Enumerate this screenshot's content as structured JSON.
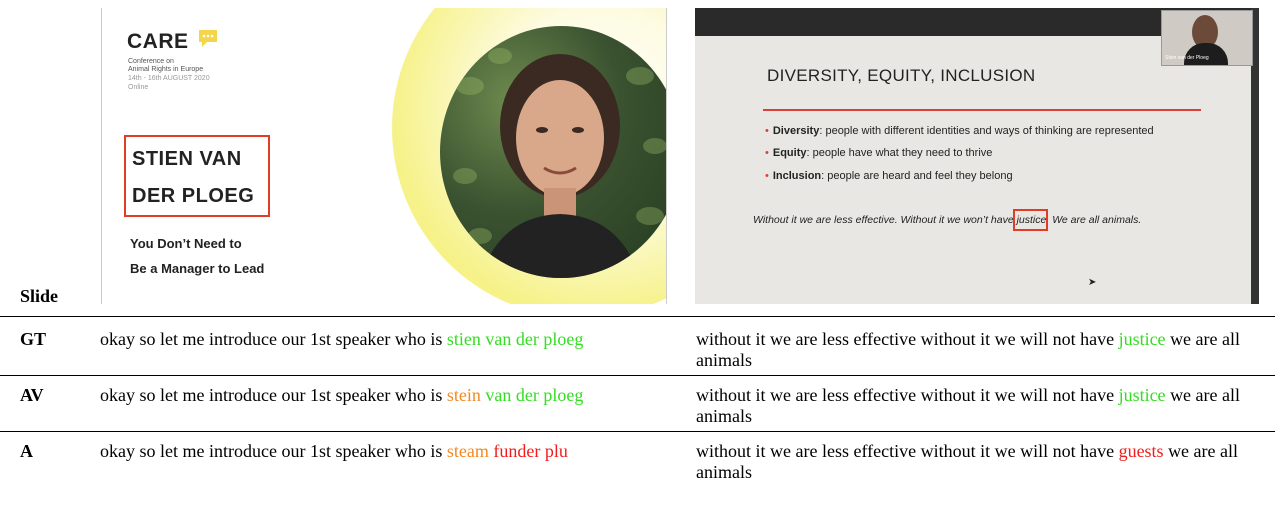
{
  "slide1": {
    "logo": "CARE",
    "conf_lines": [
      "Conference on",
      "Animal Rights in Europe",
      "14th - 16th AUGUST 2020",
      "Online"
    ],
    "name_lines": [
      "STIEN VAN",
      "DER PLOEG"
    ],
    "talk_lines": [
      "You Don’t Need to",
      "Be a Manager to Lead"
    ]
  },
  "slide2": {
    "camera_label": "Stien van der Ploeg",
    "title": "DIVERSITY, EQUITY, INCLUSION",
    "bullets": [
      {
        "term": "Diversity",
        "text": ": people with different identities and ways of thinking are represented"
      },
      {
        "term": "Equity",
        "text": ": people have what they need to thrive"
      },
      {
        "term": "Inclusion",
        "text": ": people are heard and feel they belong"
      }
    ],
    "quote_pre": "Without it we are less effective. Without it we won’t have ",
    "quote_word": "justice",
    "quote_post": ". We are all animals."
  },
  "table": {
    "slide_label": "Slide",
    "rows": [
      {
        "label": "GT",
        "col1": [
          {
            "text": "okay so let me introduce our 1st speaker who is ",
            "color": "#000000"
          },
          {
            "text": "stien van der ploeg",
            "color": "#33dd22"
          }
        ],
        "col2": [
          {
            "text": "without it we are less effective without it we will not have ",
            "color": "#000000"
          },
          {
            "text": "justice",
            "color": "#33dd22"
          },
          {
            "text": " we are all animals",
            "color": "#000000"
          }
        ]
      },
      {
        "label": "AV",
        "col1": [
          {
            "text": "okay so let me introduce our 1st speaker who is ",
            "color": "#000000"
          },
          {
            "text": "stein",
            "color": "#f08a24"
          },
          {
            "text": " ",
            "color": "#000000"
          },
          {
            "text": "van der ploeg",
            "color": "#33dd22"
          }
        ],
        "col2": [
          {
            "text": "without it we are less effective without it we will not have ",
            "color": "#000000"
          },
          {
            "text": "justice",
            "color": "#33dd22"
          },
          {
            "text": " we are all animals",
            "color": "#000000"
          }
        ]
      },
      {
        "label": "A",
        "col1": [
          {
            "text": "okay so let me introduce our 1st speaker who is ",
            "color": "#000000"
          },
          {
            "text": "steam",
            "color": "#f08a24"
          },
          {
            "text": " ",
            "color": "#000000"
          },
          {
            "text": "funder plu",
            "color": "#ee1c1c"
          }
        ],
        "col2": [
          {
            "text": "without it we are less effective without it we will not have ",
            "color": "#000000"
          },
          {
            "text": "guests",
            "color": "#ee1c1c"
          },
          {
            "text": " we are all animals",
            "color": "#000000"
          }
        ]
      }
    ]
  }
}
